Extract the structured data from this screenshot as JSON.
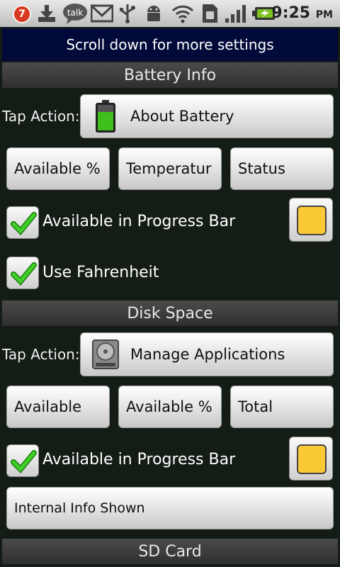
{
  "status_bar": {
    "notification_count": "7",
    "talk_label": "talk",
    "time": "9:25",
    "ampm": "PM",
    "icons": [
      "download-icon",
      "talk-icon",
      "gmail-icon",
      "usb-icon",
      "android-icon",
      "wifi-icon",
      "sim-icon",
      "signal-icon",
      "battery-charging-icon"
    ]
  },
  "hint": "Scroll down for more settings",
  "battery": {
    "header": "Battery Info",
    "tap_action_label": "Tap Action:",
    "action_button": "About Battery",
    "options": [
      "Available %",
      "Temperatur",
      "Status"
    ],
    "progress_checkbox_label": "Available in Progress Bar",
    "progress_checked": true,
    "fahrenheit_label": "Use Fahrenheit",
    "fahrenheit_checked": true,
    "color": "#fbc935"
  },
  "disk": {
    "header": "Disk Space",
    "tap_action_label": "Tap Action:",
    "action_button": "Manage Applications",
    "options": [
      "Available",
      "Available %",
      "Total"
    ],
    "progress_checkbox_label": "Available in Progress Bar",
    "progress_checked": true,
    "info_button": "Internal Info Shown",
    "color": "#fbc935"
  },
  "sd": {
    "header": "SD Card"
  }
}
